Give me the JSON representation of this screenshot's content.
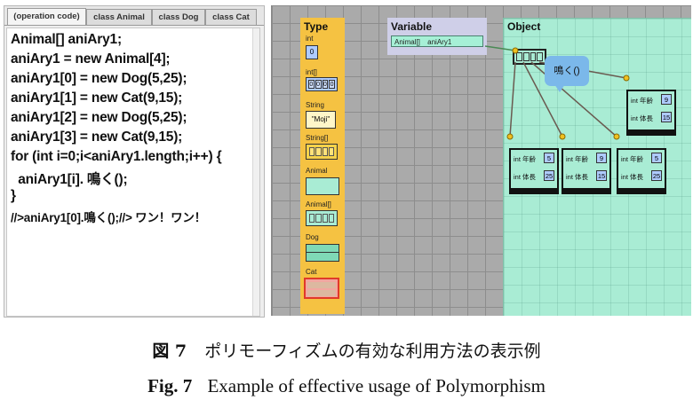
{
  "tabs": [
    "(operation code)",
    "class Animal",
    "class Dog",
    "class Cat"
  ],
  "code_lines": [
    "Animal[] aniAry1;",
    "aniAry1 = new Animal[4];",
    "aniAry1[0] = new Dog(5,25);",
    "aniAry1[1] = new Cat(9,15);",
    "aniAry1[2] = new Dog(5,25);",
    "aniAry1[3] = new Cat(9,15);",
    "for (int i=0;i<aniAry1.length;i++) {",
    "  aniAry1[i]. 鳴く();",
    "}",
    "//>aniAry1[0].鳴く();//> ワン！ワン！"
  ],
  "type_panel": {
    "title": "Type",
    "int_label": "int",
    "int_value": "0",
    "int_array_label": "int[]",
    "int_array_values": [
      "0",
      "0",
      "0",
      "0"
    ],
    "string_label": "String",
    "string_value": "\"Moji\"",
    "string_array_label": "String[]",
    "animal_label": "Animal",
    "animal_array_label": "Animal[]",
    "dog_label": "Dog",
    "cat_label": "Cat"
  },
  "variable_panel": {
    "title": "Variable",
    "var_type": "Animal[]",
    "var_name": "aniAry1"
  },
  "object_panel": {
    "title": "Object",
    "objects": [
      {
        "age_label": "int 年齢",
        "age": "5",
        "height_label": "int 体長",
        "height": "25"
      },
      {
        "age_label": "int 年齢",
        "age": "9",
        "height_label": "int 体長",
        "height": "15"
      },
      {
        "age_label": "int 年齢",
        "age": "5",
        "height_label": "int 体長",
        "height": "25"
      },
      {
        "age_label": "int 年齢",
        "age": "9",
        "height_label": "int 体長",
        "height": "15"
      }
    ],
    "bubble_text": "鳴く()"
  },
  "colors": {
    "type_panel": "#f5c242",
    "variable_panel": "#cfcfe8",
    "object_panel": "#a9ecd4",
    "value_box": "#aecbff",
    "cat_box": "#f2a6a0",
    "bubble": "#7bb8ea"
  },
  "caption": {
    "ja_fig": "図 7",
    "ja_text": "ポリモーフィズムの有効な利用方法の表示例",
    "en_fig": "Fig. 7",
    "en_text": "Example of effective usage of Polymorphism"
  }
}
